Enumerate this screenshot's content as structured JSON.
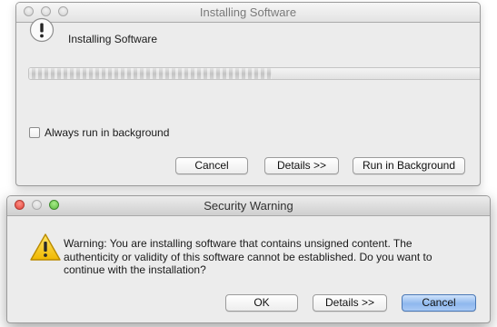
{
  "install_window": {
    "title": "Installing Software",
    "heading": "Installing Software",
    "progress_fraction": 0.53,
    "checkbox_label": "Always run in background",
    "checkbox_checked": false,
    "buttons": {
      "cancel": "Cancel",
      "details": "Details >>",
      "run_background": "Run in Background"
    }
  },
  "warning_window": {
    "title": "Security Warning",
    "message_lines": [
      "Warning: You are installing software that contains unsigned content. The",
      "authenticity or validity of this software cannot be established. Do you want to",
      "continue with the installation?"
    ],
    "buttons": {
      "ok": "OK",
      "details": "Details >>",
      "cancel": "Cancel"
    }
  },
  "colors": {
    "window_bg": "#ececec",
    "default_button": "#8fb8ee",
    "warning_yellow": "#f2c200",
    "close_red": "#e0443a",
    "minimize_yellow": "#e8ac2b",
    "zoom_green": "#5dbb40"
  },
  "icons": {
    "install": "info-exclamation-icon",
    "warning": "warning-triangle-icon"
  }
}
